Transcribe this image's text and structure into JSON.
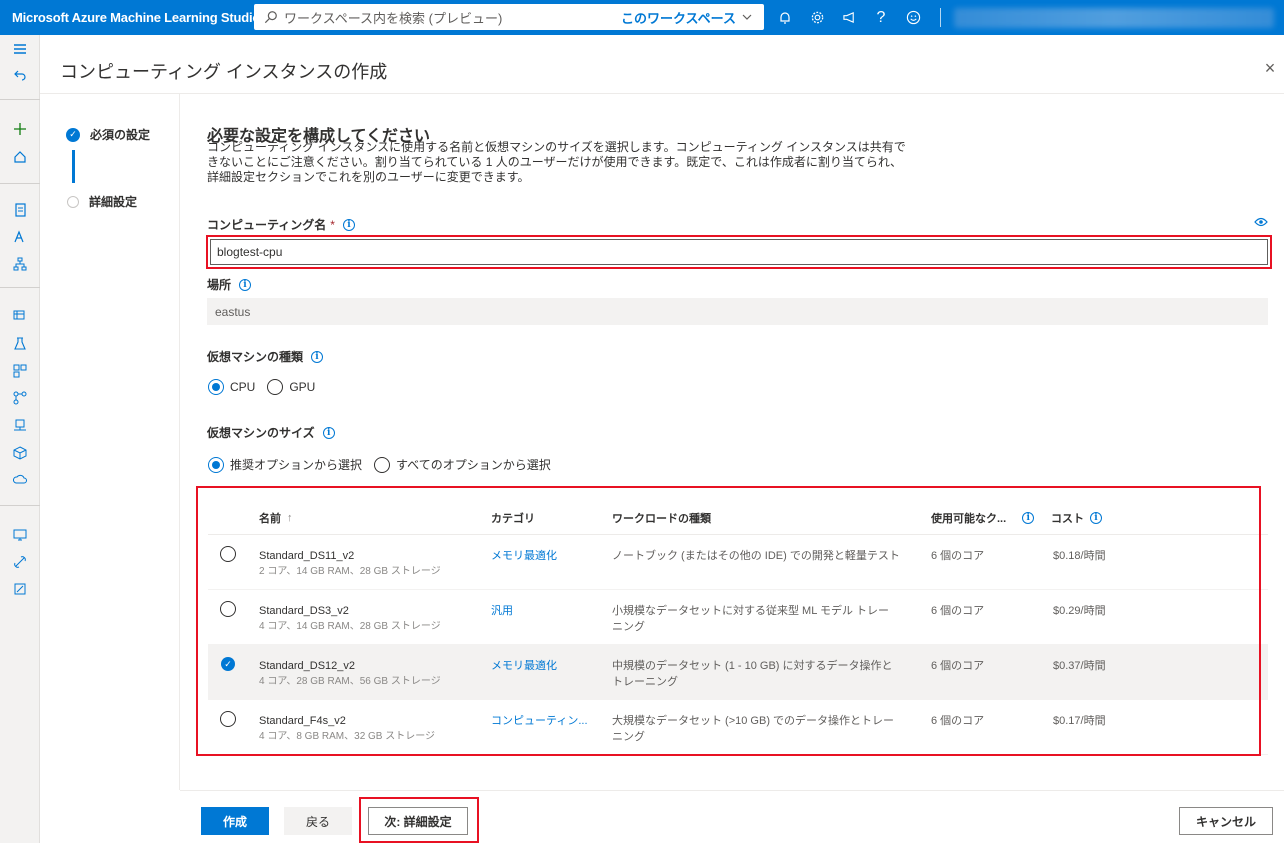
{
  "app": {
    "title": "Microsoft Azure Machine Learning Studio",
    "search_placeholder": "ワークスペース内を検索 (プレビュー)",
    "search_scope": "このワークスペース"
  },
  "panel": {
    "title": "コンピューティング インスタンスの作成",
    "steps": [
      {
        "label": "必須の設定",
        "done": true
      },
      {
        "label": "詳細設定",
        "done": false
      }
    ]
  },
  "form": {
    "heading": "必要な設定を構成してください",
    "description": "コンピューティング インスタンスに使用する名前と仮想マシンのサイズを選択します。コンピューティング インスタンスは共有できないことにご注意ください。割り当てられている 1 人のユーザーだけが使用できます。既定で、これは作成者に割り当てられ、詳細設定セクションでこれを別のユーザーに変更できます。",
    "name_label": "コンピューティング名",
    "name_required": "*",
    "name_value": "blogtest-cpu",
    "location_label": "場所",
    "location_value": "eastus",
    "vm_type_label": "仮想マシンの種類",
    "vm_type_options": [
      "CPU",
      "GPU"
    ],
    "vm_type_selected": "CPU",
    "vm_size_label": "仮想マシンのサイズ",
    "vm_size_options": [
      "推奨オプションから選択",
      "すべてのオプションから選択"
    ],
    "vm_size_selected": "推奨オプションから選択"
  },
  "table": {
    "columns": [
      "名前",
      "カテゴリ",
      "ワークロードの種類",
      "使用可能なク...",
      "コスト"
    ],
    "sort_indicator": "↑",
    "rows": [
      {
        "name": "Standard_DS11_v2",
        "spec": "2 コア、14 GB RAM、28 GB ストレージ",
        "category": "メモリ最適化",
        "workload": "ノートブック (またはその他の IDE) での開発と軽量テスト",
        "workload2": "",
        "quota": "6 個のコア",
        "cost": "$0.18/時間",
        "selected": false
      },
      {
        "name": "Standard_DS3_v2",
        "spec": "4 コア、14 GB RAM、28 GB ストレージ",
        "category": "汎用",
        "workload": "小規模なデータセットに対する従来型 ML モデル トレー",
        "workload2": "ニング",
        "quota": "6 個のコア",
        "cost": "$0.29/時間",
        "selected": false
      },
      {
        "name": "Standard_DS12_v2",
        "spec": "4 コア、28 GB RAM、56 GB ストレージ",
        "category": "メモリ最適化",
        "workload": "中規模のデータセット (1 - 10 GB) に対するデータ操作と",
        "workload2": "トレーニング",
        "quota": "6 個のコア",
        "cost": "$0.37/時間",
        "selected": true
      },
      {
        "name": "Standard_F4s_v2",
        "spec": "4 コア、8 GB RAM、32 GB ストレージ",
        "category": "コンピューティン...",
        "workload": "大規模なデータセット (>10 GB) でのデータ操作とトレー",
        "workload2": "ニング",
        "quota": "6 個のコア",
        "cost": "$0.17/時間",
        "selected": false
      }
    ]
  },
  "footer": {
    "create": "作成",
    "back": "戻る",
    "next": "次: 詳細設定",
    "cancel": "キャンセル"
  },
  "icons": {
    "info": "i",
    "close": "×",
    "check": "✓"
  },
  "colors": {
    "brand": "#0078d4",
    "highlight": "#e81123"
  }
}
